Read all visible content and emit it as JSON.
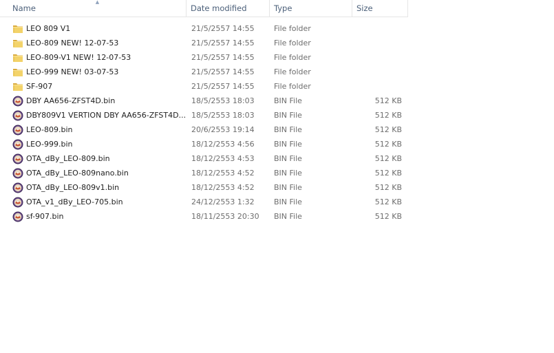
{
  "columns": {
    "name": "Name",
    "date": "Date modified",
    "type": "Type",
    "size": "Size"
  },
  "sort": {
    "column": "name",
    "direction": "ascending",
    "icon": "sort-up-arrow-icon"
  },
  "colors": {
    "folder": "#e8c14a",
    "header_text": "#4c607a",
    "meta_text": "#6d6d6d"
  },
  "files": [
    {
      "name": "LEO 809 V1",
      "date": "21/5/2557 14:55",
      "type": "File folder",
      "size": "",
      "icon": "folder-icon"
    },
    {
      "name": "LEO-809 NEW! 12-07-53",
      "date": "21/5/2557 14:55",
      "type": "File folder",
      "size": "",
      "icon": "folder-icon"
    },
    {
      "name": "LEO-809-V1 NEW! 12-07-53",
      "date": "21/5/2557 14:55",
      "type": "File folder",
      "size": "",
      "icon": "folder-icon"
    },
    {
      "name": "LEO-999 NEW! 03-07-53",
      "date": "21/5/2557 14:55",
      "type": "File folder",
      "size": "",
      "icon": "folder-icon"
    },
    {
      "name": "SF-907",
      "date": "21/5/2557 14:55",
      "type": "File folder",
      "size": "",
      "icon": "folder-icon"
    },
    {
      "name": "DBY AA656-ZFST4D.bin",
      "date": "18/5/2553 18:03",
      "type": "BIN File",
      "size": "512 KB",
      "icon": "bin-file-icon"
    },
    {
      "name": "DBY809V1 VERTION DBY AA656-ZFST4D....",
      "date": "18/5/2553 18:03",
      "type": "BIN File",
      "size": "512 KB",
      "icon": "bin-file-icon"
    },
    {
      "name": "LEO-809.bin",
      "date": "20/6/2553 19:14",
      "type": "BIN File",
      "size": "512 KB",
      "icon": "bin-file-icon"
    },
    {
      "name": "LEO-999.bin",
      "date": "18/12/2553 4:56",
      "type": "BIN File",
      "size": "512 KB",
      "icon": "bin-file-icon"
    },
    {
      "name": "OTA_dBy_LEO-809.bin",
      "date": "18/12/2553 4:53",
      "type": "BIN File",
      "size": "512 KB",
      "icon": "bin-file-icon"
    },
    {
      "name": "OTA_dBy_LEO-809nano.bin",
      "date": "18/12/2553 4:52",
      "type": "BIN File",
      "size": "512 KB",
      "icon": "bin-file-icon"
    },
    {
      "name": "OTA_dBy_LEO-809v1.bin",
      "date": "18/12/2553 4:52",
      "type": "BIN File",
      "size": "512 KB",
      "icon": "bin-file-icon"
    },
    {
      "name": "OTA_v1_dBy_LEO-705.bin",
      "date": "24/12/2553 1:32",
      "type": "BIN File",
      "size": "512 KB",
      "icon": "bin-file-icon"
    },
    {
      "name": "sf-907.bin",
      "date": "18/11/2553 20:30",
      "type": "BIN File",
      "size": "512 KB",
      "icon": "bin-file-icon"
    }
  ]
}
